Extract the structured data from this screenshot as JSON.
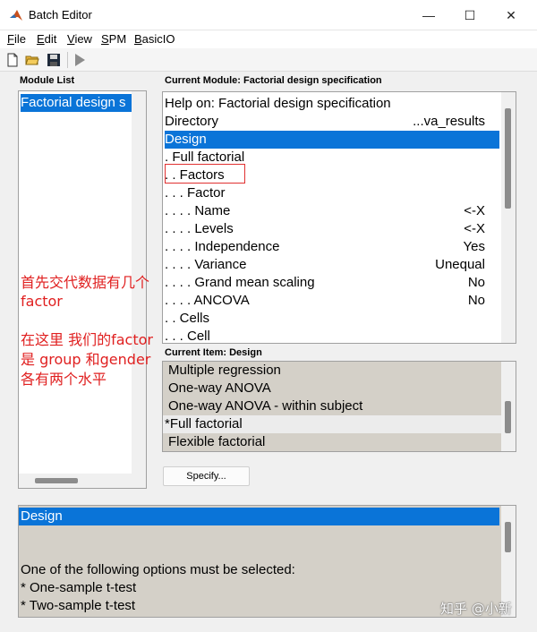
{
  "window": {
    "title": "Batch Editor",
    "minimize": "—",
    "maximize": "☐",
    "close": "✕"
  },
  "menu": [
    {
      "first": "F",
      "rest": "ile"
    },
    {
      "first": "E",
      "rest": "dit"
    },
    {
      "first": "V",
      "rest": "iew"
    },
    {
      "first": "S",
      "rest": "PM"
    },
    {
      "first": "B",
      "rest": "asicIO"
    }
  ],
  "toolbar": {
    "icons": [
      "new-file-icon",
      "open-folder-icon",
      "save-icon",
      "run-icon"
    ]
  },
  "module_list": {
    "label": "Module List",
    "items": [
      "Factorial design s"
    ]
  },
  "current_module": {
    "label": "Current Module: Factorial design specification",
    "rows": [
      {
        "name": "Help on: Factorial design specification",
        "value": ""
      },
      {
        "name": "Directory",
        "value": "...va_results"
      },
      {
        "name": "Design",
        "value": ""
      },
      {
        "name": ". Full factorial",
        "value": ""
      },
      {
        "name": ". . Factors",
        "value": ""
      },
      {
        "name": ". . . Factor",
        "value": ""
      },
      {
        "name": ". . . . Name",
        "value": "<-X"
      },
      {
        "name": ". . . . Levels",
        "value": "<-X"
      },
      {
        "name": ". . . . Independence",
        "value": "Yes"
      },
      {
        "name": ". . . . Variance",
        "value": "Unequal"
      },
      {
        "name": ". . . . Grand mean scaling",
        "value": "No"
      },
      {
        "name": ". . . . ANCOVA",
        "value": "No"
      },
      {
        "name": ". . Cells",
        "value": ""
      },
      {
        "name": ". . . Cell",
        "value": ""
      }
    ]
  },
  "current_item": {
    "label": "Current Item: Design",
    "options": [
      "Multiple regression",
      "One-way ANOVA",
      "One-way ANOVA - within subject",
      "*Full factorial",
      "Flexible factorial"
    ]
  },
  "specify_button": "Specify...",
  "help_panel": {
    "title": "Design",
    "lines": [
      "One of the following options must be selected:",
      "* One-sample t-test",
      "* Two-sample t-test"
    ]
  },
  "annotations": {
    "line1": "首先交代数据有几个",
    "line2": "factor",
    "line3": "在这里 我们的factor",
    "line4": "是 group 和gender",
    "line5": "各有两个水平"
  },
  "watermark": "知乎 @小新",
  "colors": {
    "selection": "#0a74d8",
    "annotation": "#e02020"
  }
}
